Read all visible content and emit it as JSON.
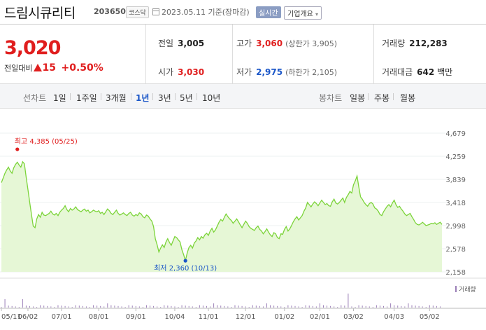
{
  "header": {
    "title": "드림시큐리티",
    "code": "203650",
    "market": "코스닥",
    "date_text": "2023.05.11 기준(장마감)",
    "realtime_label": "실시간",
    "company_info_label": "기업개요"
  },
  "summary": {
    "current_price": "3,020",
    "diff_label": "전일대비",
    "diff_value": "15",
    "diff_pct": "+0.50%",
    "prev_close_label": "전일",
    "prev_close": "3,005",
    "high_label": "고가",
    "high": "3,060",
    "upper_limit": "(상한가 3,905)",
    "volume_label": "거래량",
    "volume": "212,283",
    "open_label": "시가",
    "open": "3,030",
    "low_label": "저가",
    "low": "2,975",
    "lower_limit": "(하한가 2,105)",
    "amount_label": "거래대금",
    "amount": "642",
    "amount_unit": "백만"
  },
  "tabs": {
    "line_label": "선차트",
    "line_periods": [
      "1일",
      "1주일",
      "3개월",
      "1년",
      "3년",
      "5년",
      "10년"
    ],
    "active_period": "1년",
    "candle_label": "봉차트",
    "candle_periods": [
      "일봉",
      "주봉",
      "월봉"
    ]
  },
  "colors": {
    "up": "#e01e1e",
    "down": "#1a56c8",
    "line": "#7cd43a",
    "fill": "#e6f7d6",
    "volume": "#9b7fb8"
  },
  "chart_data": {
    "type": "area",
    "y_ticks": [
      "4,679",
      "4,259",
      "3,839",
      "3,418",
      "2,998",
      "2,578",
      "2,158"
    ],
    "ylim": [
      2158,
      4679
    ],
    "x_ticks": [
      "05/11",
      "06/02",
      "07/01",
      "08/01",
      "09/01",
      "10/04",
      "11/01",
      "12/01",
      "01/02",
      "02/01",
      "03/02",
      "04/03",
      "05/02"
    ],
    "x_tick_index": [
      0,
      15,
      34,
      55,
      76,
      98,
      117,
      138,
      160,
      180,
      199,
      222,
      242
    ],
    "high_annotation": "최고 4,385 (05/25)",
    "high_value": 4385,
    "high_index": 9,
    "low_annotation": "최저 2,360 (10/13)",
    "low_value": 2360,
    "low_index": 104,
    "volume_legend": "거래량",
    "volume_spike_index": [
      2,
      5,
      9,
      12,
      33,
      60,
      103,
      120,
      150,
      180,
      196,
      199,
      203,
      207,
      220,
      230
    ],
    "price_points": [
      3780,
      3860,
      3950,
      4010,
      4060,
      3990,
      3950,
      4050,
      4110,
      4150,
      4100,
      4060,
      4160,
      4120,
      3880,
      3650,
      3420,
      3200,
      2990,
      2960,
      3120,
      3200,
      3150,
      3240,
      3190,
      3180,
      3200,
      3220,
      3260,
      3210,
      3190,
      3220,
      3180,
      3240,
      3280,
      3310,
      3360,
      3290,
      3250,
      3310,
      3280,
      3300,
      3340,
      3290,
      3270,
      3250,
      3280,
      3300,
      3260,
      3280,
      3230,
      3250,
      3280,
      3260,
      3250,
      3270,
      3220,
      3240,
      3200,
      3250,
      3300,
      3270,
      3220,
      3200,
      3240,
      3280,
      3220,
      3190,
      3210,
      3230,
      3200,
      3180,
      3220,
      3240,
      3190,
      3170,
      3200,
      3180,
      3230,
      3210,
      3160,
      3140,
      3190,
      3170,
      3120,
      3080,
      2980,
      2760,
      2650,
      2520,
      2590,
      2650,
      2600,
      2700,
      2760,
      2690,
      2640,
      2720,
      2800,
      2780,
      2740,
      2700,
      2560,
      2470,
      2360,
      2500,
      2600,
      2640,
      2590,
      2680,
      2720,
      2780,
      2740,
      2800,
      2770,
      2830,
      2860,
      2820,
      2900,
      2950,
      2880,
      2920,
      2990,
      3060,
      3110,
      3080,
      3150,
      3210,
      3160,
      3120,
      3090,
      3040,
      3080,
      3120,
      3070,
      3010,
      2960,
      3020,
      3080,
      3040,
      2980,
      2950,
      2930,
      2910,
      2960,
      2990,
      2930,
      2900,
      2850,
      2890,
      2940,
      2880,
      2830,
      2800,
      2870,
      2850,
      2780,
      2760,
      2850,
      2840,
      2930,
      2980,
      2900,
      2940,
      3000,
      3070,
      3120,
      3160,
      3100,
      3140,
      3180,
      3260,
      3320,
      3420,
      3380,
      3340,
      3390,
      3430,
      3400,
      3360,
      3410,
      3460,
      3420,
      3380,
      3400,
      3360,
      3350,
      3430,
      3480,
      3410,
      3390,
      3420,
      3460,
      3500,
      3420,
      3510,
      3560,
      3620,
      3590,
      3740,
      3810,
      3900,
      3700,
      3520,
      3480,
      3420,
      3380,
      3350,
      3400,
      3420,
      3390,
      3320,
      3300,
      3260,
      3200,
      3180,
      3250,
      3300,
      3350,
      3380,
      3340,
      3410,
      3460,
      3380,
      3330,
      3350,
      3300,
      3260,
      3210,
      3180,
      3200,
      3220,
      3160,
      3110,
      3050,
      3020,
      3010,
      3030,
      3060,
      3030,
      3000,
      3010,
      3020,
      3040,
      3030,
      3050,
      3020,
      3040,
      3060,
      3020
    ]
  }
}
